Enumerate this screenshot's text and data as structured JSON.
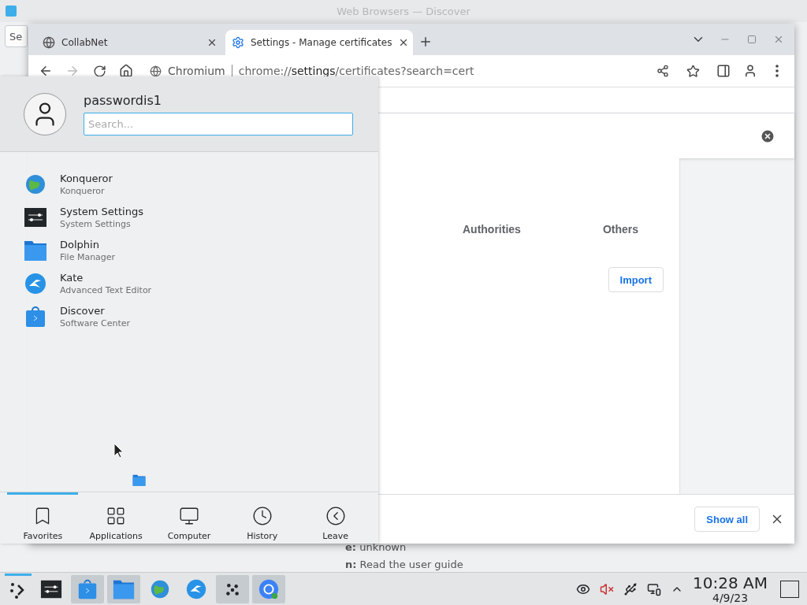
{
  "discover": {
    "title": "Web Browsers — Discover",
    "search": {
      "value": "Se"
    },
    "details": [
      {
        "text": "**e:** unknown"
      },
      {
        "text": "**n:** Read the user guide"
      }
    ]
  },
  "browser": {
    "tabs": [
      {
        "title": "CollabNet",
        "selected": false,
        "kind": "globe"
      },
      {
        "title": "Settings - Manage certificates",
        "selected": true,
        "kind": "gear"
      }
    ],
    "omnibox": {
      "origin": "Chromium",
      "url": "chrome://**settings**/certificates?search=cert"
    },
    "forward_disabled": true,
    "cert_tabs": [
      {
        "label": "Authorities",
        "selected": false
      },
      {
        "label": "Others",
        "selected": false
      }
    ],
    "import_button": "Import",
    "downloads": {
      "button": "Show all"
    }
  },
  "menu": {
    "user": "passwordis1",
    "search": {
      "placeholder": "Search..."
    },
    "apps": [
      {
        "name": "Konqueror",
        "subtitle": "Konqueror",
        "kind": "globe"
      },
      {
        "name": "System Settings",
        "subtitle": "System Settings",
        "kind": "settings"
      },
      {
        "name": "Dolphin",
        "subtitle": "File Manager",
        "kind": "folder"
      },
      {
        "name": "Kate",
        "subtitle": "Advanced Text Editor",
        "kind": "kate"
      },
      {
        "name": "Discover",
        "subtitle": "Software Center",
        "kind": "store"
      }
    ],
    "nav": [
      {
        "label": "Favorites",
        "selected": true,
        "kind": "bookmark"
      },
      {
        "label": "Applications",
        "selected": false,
        "kind": "grid"
      },
      {
        "label": "Computer",
        "selected": false,
        "kind": "monitor"
      },
      {
        "label": "History",
        "selected": false,
        "kind": "clock"
      },
      {
        "label": "Leave",
        "selected": false,
        "kind": "leave"
      }
    ]
  },
  "taskbar": {
    "tasks": [
      {
        "kind": "settings",
        "active": false
      },
      {
        "kind": "store",
        "active": true
      },
      {
        "kind": "folder",
        "active": true
      },
      {
        "kind": "globe",
        "active": false
      },
      {
        "kind": "kate",
        "active": false
      },
      {
        "kind": "dots",
        "active": true
      },
      {
        "kind": "chromium",
        "active": true
      }
    ],
    "clock": {
      "time": "10:28 AM",
      "date": "4/9/23"
    }
  }
}
